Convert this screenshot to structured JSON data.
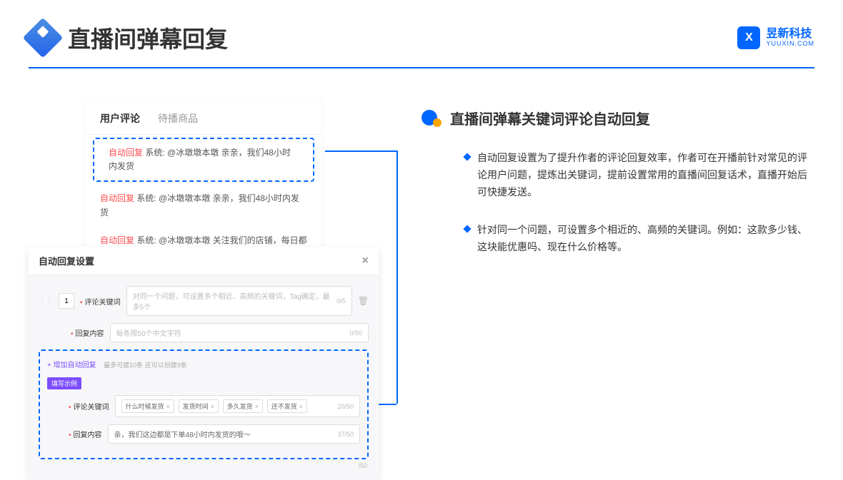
{
  "header": {
    "title": "直播间弹幕回复",
    "brand_cn": "昱新科技",
    "brand_en": "YUUXIN.COM",
    "brand_logo": "X"
  },
  "comments": {
    "tab_active": "用户评论",
    "tab_inactive": "待播商品",
    "auto_tag": "自动回复",
    "sys_prefix": "系统:",
    "row1": "@冰墩墩本墩 亲亲，我们48小时内发货",
    "row2": "@冰墩墩本墩 亲亲，我们48小时内发货",
    "row3": "@冰墩墩本墩 关注我们的店铺，每日都有热门推荐呦～"
  },
  "settings": {
    "title": "自动回复设置",
    "seq": "1",
    "kw_label": "评论关键词",
    "kw_placeholder": "对同一个问题，可设置多个相近、高频的关键词，Tag确定，最多5个",
    "kw_count": "0/5",
    "content_label": "回复内容",
    "content_placeholder": "每条限50个中文字符",
    "content_count": "0/50",
    "add_text": "+ 增加自动回复",
    "add_sub": "最多可建10条 还可以创建9条",
    "example_badge": "填写示例",
    "ex_kw_label": "评论关键词",
    "tags": [
      "什么时候发货",
      "发货时间",
      "多久发货",
      "还不发货"
    ],
    "ex_kw_count": "20/50",
    "ex_content_label": "回复内容",
    "ex_content": "亲，我们这边都是下单48小时内发货的哦～",
    "ex_content_count": "37/50",
    "extra_count": "/50"
  },
  "right": {
    "heading": "直播间弹幕关键词评论自动回复",
    "bullet1": "自动回复设置为了提升作者的评论回复效率，作者可在开播前针对常见的评论用户问题，提炼出关键词，提前设置常用的直播间回复话术，直播开始后可快捷发送。",
    "bullet2": "针对同一个问题，可设置多个相近的、高频的关键词。例如：这款多少钱、这块能优惠吗、现在什么价格等。"
  }
}
